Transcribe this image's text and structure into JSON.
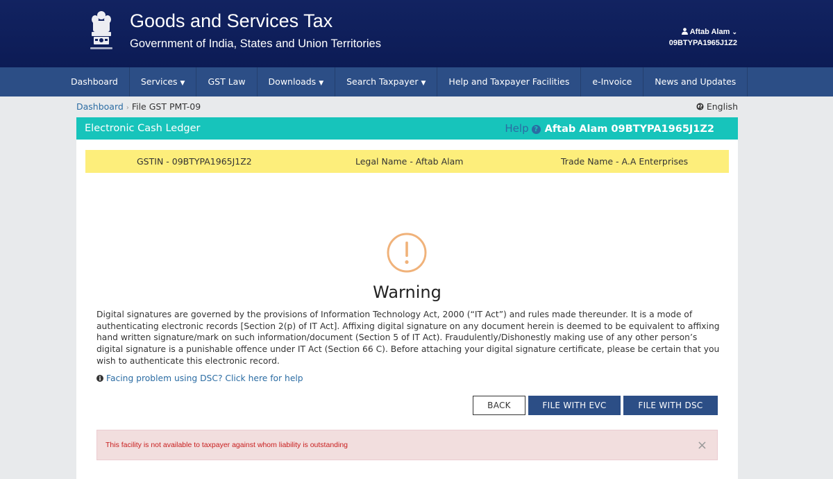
{
  "header": {
    "title": "Goods and Services Tax",
    "subtitle": "Government of India, States and Union Territories",
    "user_name": "Aftab Alam",
    "user_gstin": "09BTYPA1965J1Z2"
  },
  "nav": {
    "items": [
      {
        "label": "Dashboard",
        "dropdown": false
      },
      {
        "label": "Services",
        "dropdown": true
      },
      {
        "label": "GST Law",
        "dropdown": false
      },
      {
        "label": "Downloads",
        "dropdown": true
      },
      {
        "label": "Search Taxpayer",
        "dropdown": true
      },
      {
        "label": "Help and Taxpayer Facilities",
        "dropdown": false
      },
      {
        "label": "e-Invoice",
        "dropdown": false
      },
      {
        "label": "News and Updates",
        "dropdown": false
      }
    ]
  },
  "breadcrumb": {
    "home": "Dashboard",
    "current": "File GST PMT-09"
  },
  "language": "English",
  "panel": {
    "title": "Electronic Cash Ledger",
    "help": "Help",
    "user_info": "Aftab Alam 09BTYPA1965J1Z2",
    "gstin": "GSTIN - 09BTYPA1965J1Z2",
    "legal_name": "Legal Name - Aftab Alam",
    "trade_name": "Trade Name - A.A Enterprises"
  },
  "warning": {
    "title": "Warning",
    "text": "Digital signatures are governed by the provisions of Information Technology Act, 2000 (“IT Act”) and rules made thereunder. It is a mode of authenticating electronic records [Section 2(p) of IT Act]. Affixing digital signature on any document herein is deemed to be equivalent to affixing hand written signature/mark on such information/document (Section 5 of IT Act). Fraudulently/Dishonestly making use of any other person’s digital signature is a punishable offence under IT Act (Section 66 C). Before attaching your digital signature certificate, please be certain that you wish to authenticate this electronic record.",
    "dsc_help": "Facing problem using DSC? Click here for help"
  },
  "buttons": {
    "back": "BACK",
    "file_evc": "FILE WITH EVC",
    "file_dsc": "FILE WITH DSC"
  },
  "alert": {
    "message": "This facility is not available to taxpayer against whom liability is outstanding",
    "close": "×"
  },
  "colors": {
    "header_bg": "#0f1f5c",
    "nav_bg": "#2c4e86",
    "panel_head_bg": "#17c4bb",
    "info_bar_bg": "#fdee7b",
    "warning_icon": "#f0b27a",
    "alert_bg": "#f2dede",
    "alert_text": "#c81d1d"
  },
  "icons": {
    "emblem": "national-emblem-icon",
    "user": "user-icon",
    "globe": "globe-icon",
    "help": "question-circle-icon",
    "warning": "exclamation-circle-icon",
    "info": "info-circle-icon",
    "close": "close-icon"
  }
}
